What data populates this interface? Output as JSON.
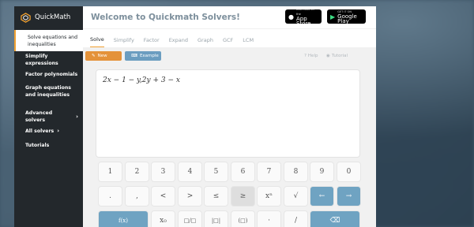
{
  "app": {
    "brand": "QuickMath"
  },
  "sidebar": {
    "items": [
      {
        "label": "Solve equations and inequalities",
        "active": true
      },
      {
        "label": "Simplify expressions"
      },
      {
        "label": "Factor polynomials"
      },
      {
        "label": "Graph equations and inequalities"
      },
      {
        "label": "Advanced solvers"
      },
      {
        "label": "All solvers"
      },
      {
        "label": "Tutorials"
      }
    ]
  },
  "header": {
    "title": "Welcome to Quickmath Solvers!",
    "appstore": {
      "small": "Download on the",
      "big": "App Store"
    },
    "googleplay": {
      "small": "GET IT ON",
      "big": "Google Play"
    }
  },
  "tabs": [
    "Solve",
    "Simplify",
    "Factor",
    "Expand",
    "Graph",
    "GCF",
    "LCM"
  ],
  "toolbar": {
    "new_label": "New",
    "example_label": "Example",
    "help_label": "Help",
    "tutorial_label": "Tutorial"
  },
  "editor": {
    "expression": "2x − 1 − y,2y + 3 − x"
  },
  "keypad": {
    "row1": [
      "1",
      "2",
      "3",
      "4",
      "5",
      "6",
      "7",
      "8",
      "9",
      "0"
    ],
    "row2": [
      ".",
      ",",
      "<",
      ">",
      "≤",
      "≥",
      "xⁿ",
      "√",
      "←",
      "→"
    ],
    "row3": [
      "f(x)",
      "x₀",
      "□/□",
      "|□|",
      "(□)",
      "·",
      "/",
      "⌫"
    ]
  },
  "colors": {
    "accent": "#f0a030",
    "blue": "#6fa3c2",
    "sidebar": "#23282c"
  }
}
